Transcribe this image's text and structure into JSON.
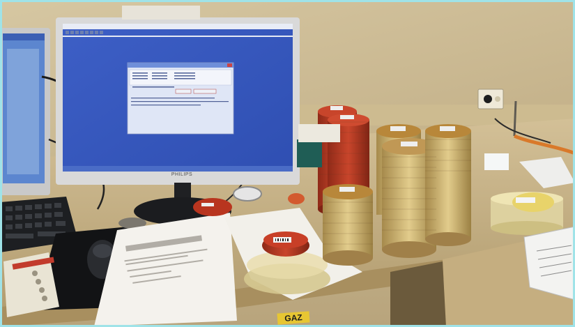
{
  "monitor": {
    "brand": "PHILIPS"
  },
  "dialog": {
    "ok_label": "",
    "cancel_label": ""
  },
  "desk": {
    "label_tag": "GAZ"
  },
  "colors": {
    "screen_blue": "#3f63c9",
    "wall": "#cfbf98",
    "desk": "#cbb88a",
    "agar_red": "#b83a22",
    "agar_yellow": "#d8c27a"
  },
  "icons": [
    "window-icon",
    "close-icon",
    "ok-icon",
    "cancel-icon"
  ]
}
